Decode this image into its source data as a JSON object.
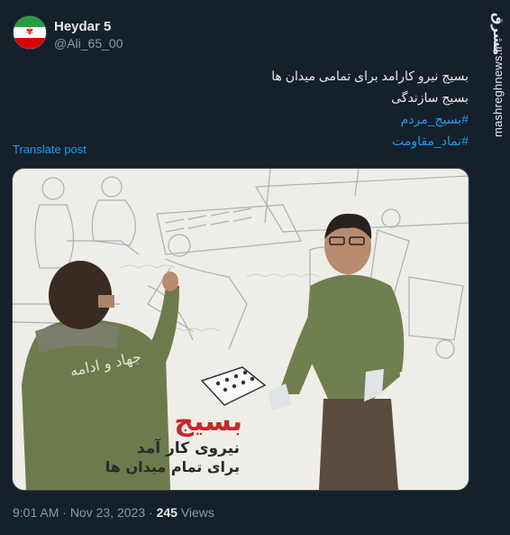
{
  "author": {
    "name": "Heydar 5",
    "handle": "@Ali_65_00"
  },
  "post": {
    "lines": [
      "بسیج نیرو کارامد برای تمامی میدان ها",
      "بسیج سازندگی"
    ],
    "hashtags": [
      "#بسیج_مردم",
      "#نماد_مقاومت"
    ],
    "translate_label": "Translate post"
  },
  "poster": {
    "title": "بسیج",
    "subtitle_1": "نیروی کار آمد",
    "subtitle_2": "برای تمام میدان ها",
    "vest_text": "جهاد و ادامه"
  },
  "footer": {
    "time": "9:01 AM",
    "separator": "·",
    "date": "Nov 23, 2023",
    "views_count": "245",
    "views_label": "Views"
  },
  "watermark": {
    "logo": "مشرق",
    "url": "mashreghnews.ir"
  },
  "colors": {
    "background": "#15202b",
    "link": "#1d9bf0",
    "secondary_text": "#8b98a5",
    "poster_red": "#c62828",
    "vest_green": "#6e7d4c"
  }
}
